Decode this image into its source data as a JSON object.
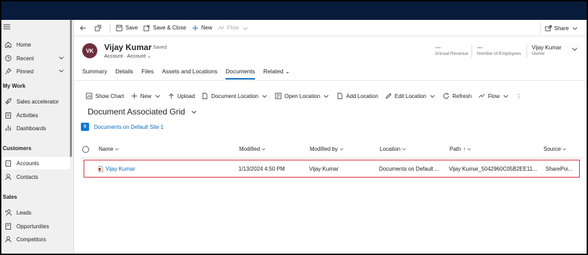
{
  "command_bar": {
    "back_label": "",
    "save_label": "Save",
    "save_close_label": "Save & Close",
    "new_label": "New",
    "flow_label": "Flow",
    "share_label": "Share"
  },
  "sidebar": {
    "items": [
      {
        "label": "Home",
        "icon": "home-icon"
      },
      {
        "label": "Recent",
        "icon": "clock-icon"
      },
      {
        "label": "Pinned",
        "icon": "pin-icon"
      }
    ],
    "sections": [
      {
        "title": "My Work",
        "items": [
          {
            "label": "Sales accelerator",
            "icon": "rocket-icon"
          },
          {
            "label": "Activities",
            "icon": "clipboard-icon"
          },
          {
            "label": "Dashboards",
            "icon": "dashboard-icon"
          }
        ]
      },
      {
        "title": "Customers",
        "items": [
          {
            "label": "Accounts",
            "icon": "building-icon"
          },
          {
            "label": "Contacts",
            "icon": "person-icon"
          }
        ]
      },
      {
        "title": "Sales",
        "items": [
          {
            "label": "Leads",
            "icon": "phone-person-icon"
          },
          {
            "label": "Opportunities",
            "icon": "document-icon"
          },
          {
            "label": "Competitors",
            "icon": "person-icon"
          }
        ]
      }
    ]
  },
  "record": {
    "initials": "VK",
    "name": "Vijay Kumar",
    "status": "- Saved",
    "type_1": "Account",
    "type_sep": "·",
    "type_2": "Account",
    "fields": [
      {
        "value": "---",
        "label": "Annual Revenue"
      },
      {
        "value": "---",
        "label": "Number of Employees"
      },
      {
        "value": "Vijay Kumar",
        "label": "Owner"
      }
    ]
  },
  "tabs": [
    {
      "label": "Summary",
      "active": false
    },
    {
      "label": "Details",
      "active": false
    },
    {
      "label": "Files",
      "active": false
    },
    {
      "label": "Assets and Locations",
      "active": false
    },
    {
      "label": "Documents",
      "active": true
    },
    {
      "label": "Related",
      "active": false
    }
  ],
  "grid_commands": [
    {
      "label": "Show Chart",
      "icon": "chart-icon"
    },
    {
      "label": "New",
      "icon": "plus-icon",
      "dropdown": true
    },
    {
      "label": "Upload",
      "icon": "upload-icon"
    },
    {
      "label": "Document Location",
      "icon": "document-location-icon",
      "dropdown": true
    },
    {
      "label": "Open Location",
      "icon": "open-location-icon",
      "dropdown": true
    },
    {
      "label": "Add Location",
      "icon": "add-location-icon"
    },
    {
      "label": "Edit Location",
      "icon": "edit-icon",
      "dropdown": true
    },
    {
      "label": "Refresh",
      "icon": "refresh-icon"
    },
    {
      "label": "Flow",
      "icon": "flow-icon",
      "dropdown": true
    }
  ],
  "grid": {
    "title": "Document Associated Grid",
    "location_link": "Documents on Default Site 1",
    "columns": [
      "Name",
      "Modified",
      "Modified by",
      "Location",
      "Path",
      "Source"
    ],
    "rows": [
      {
        "name": "Vijay Kumar",
        "modified": "1/13/2024 4:50 PM",
        "modified_by": "Vijay Kumar",
        "location": "Documents on Default ...",
        "path": "Vijay Kumar_5042960C05B2EE11...",
        "source": "SharePoi..."
      }
    ]
  }
}
